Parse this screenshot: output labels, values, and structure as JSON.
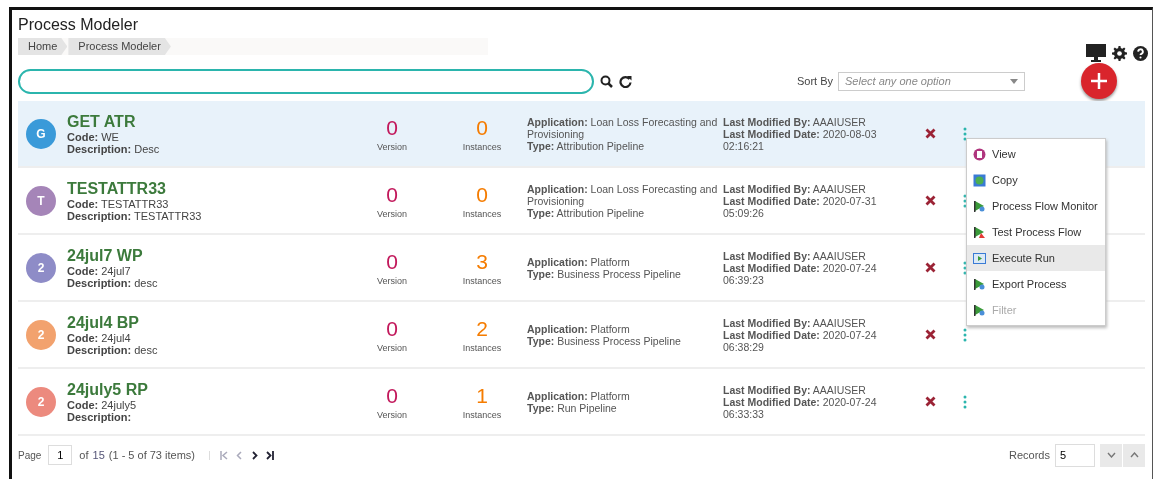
{
  "title": "Process Modeler",
  "breadcrumb": [
    {
      "label": "Home"
    },
    {
      "label": "Process Modeler"
    }
  ],
  "sort": {
    "label": "Sort By",
    "placeholder": "Select any one option"
  },
  "rows": [
    {
      "initial": "G",
      "color": "#3a9ad9",
      "name": "GET ATR",
      "code": "**Code:** WE",
      "description": "**Description:** Desc",
      "version": "0",
      "version_label": "Version",
      "instances": "0",
      "instances_label": "Instances",
      "application": "**Application:** Loan Loss Forecasting and Provisioning",
      "type": "**Type:** Attribution Pipeline",
      "modified_by": "**Last Modified By:** AAAIUSER",
      "modified_date": "**Last Modified Date:** 2020-08-03 02:16:21",
      "selected": true
    },
    {
      "initial": "T",
      "color": "#a585b8",
      "name": "TESTATTR33",
      "code": "**Code:** TESTATTR33",
      "description": "**Description:** TESTATTR33",
      "version": "0",
      "version_label": "Version",
      "instances": "0",
      "instances_label": "Instances",
      "application": "**Application:** Loan Loss Forecasting and Provisioning",
      "type": "**Type:** Attribution Pipeline",
      "modified_by": "**Last Modified By:** AAAIUSER",
      "modified_date": "**Last Modified Date:** 2020-07-31 05:09:26",
      "selected": false
    },
    {
      "initial": "2",
      "color": "#8e8cc7",
      "name": "24jul7 WP",
      "code": "**Code:** 24jul7",
      "description": "**Description:** desc",
      "version": "0",
      "version_label": "Version",
      "instances": "3",
      "instances_label": "Instances",
      "application": "**Application:** Platform",
      "type": "**Type:** Business Process Pipeline",
      "modified_by": "**Last Modified By:** AAAIUSER",
      "modified_date": "**Last Modified Date:** 2020-07-24 06:39:23",
      "selected": false
    },
    {
      "initial": "2",
      "color": "#f2a26e",
      "name": "24jul4 BP",
      "code": "**Code:** 24jul4",
      "description": "**Description:** desc",
      "version": "0",
      "version_label": "Version",
      "instances": "2",
      "instances_label": "Instances",
      "application": "**Application:** Platform",
      "type": "**Type:** Business Process Pipeline",
      "modified_by": "**Last Modified By:** AAAIUSER",
      "modified_date": "**Last Modified Date:** 2020-07-24 06:38:29",
      "selected": false
    },
    {
      "initial": "2",
      "color": "#ec8a7e",
      "name": "24july5 RP",
      "code": "**Code:** 24july5",
      "description": "**Description:**",
      "version": "0",
      "version_label": "Version",
      "instances": "1",
      "instances_label": "Instances",
      "application": "**Application:** Platform",
      "type": "**Type:** Run Pipeline",
      "modified_by": "**Last Modified By:** AAAIUSER",
      "modified_date": "**Last Modified Date:** 2020-07-24 06:33:33",
      "selected": false
    }
  ],
  "context_menu": [
    {
      "label": "View",
      "kind": "view",
      "selected": false,
      "disabled": false
    },
    {
      "label": "Copy",
      "kind": "copy",
      "selected": false,
      "disabled": false
    },
    {
      "label": "Process Flow Monitor",
      "kind": "flag",
      "selected": false,
      "disabled": false
    },
    {
      "label": "Test Process Flow",
      "kind": "test",
      "selected": false,
      "disabled": false
    },
    {
      "label": "Execute Run",
      "kind": "run",
      "selected": true,
      "disabled": false
    },
    {
      "label": "Export Process",
      "kind": "flag",
      "selected": false,
      "disabled": false
    },
    {
      "label": "Filter",
      "kind": "flag",
      "selected": false,
      "disabled": true
    }
  ],
  "pagination": {
    "page_label": "Page",
    "page": "1",
    "of": "of",
    "total_pages": "15",
    "summary": "(1 - 5 of 73 items)",
    "records_label": "Records",
    "records": "5"
  }
}
